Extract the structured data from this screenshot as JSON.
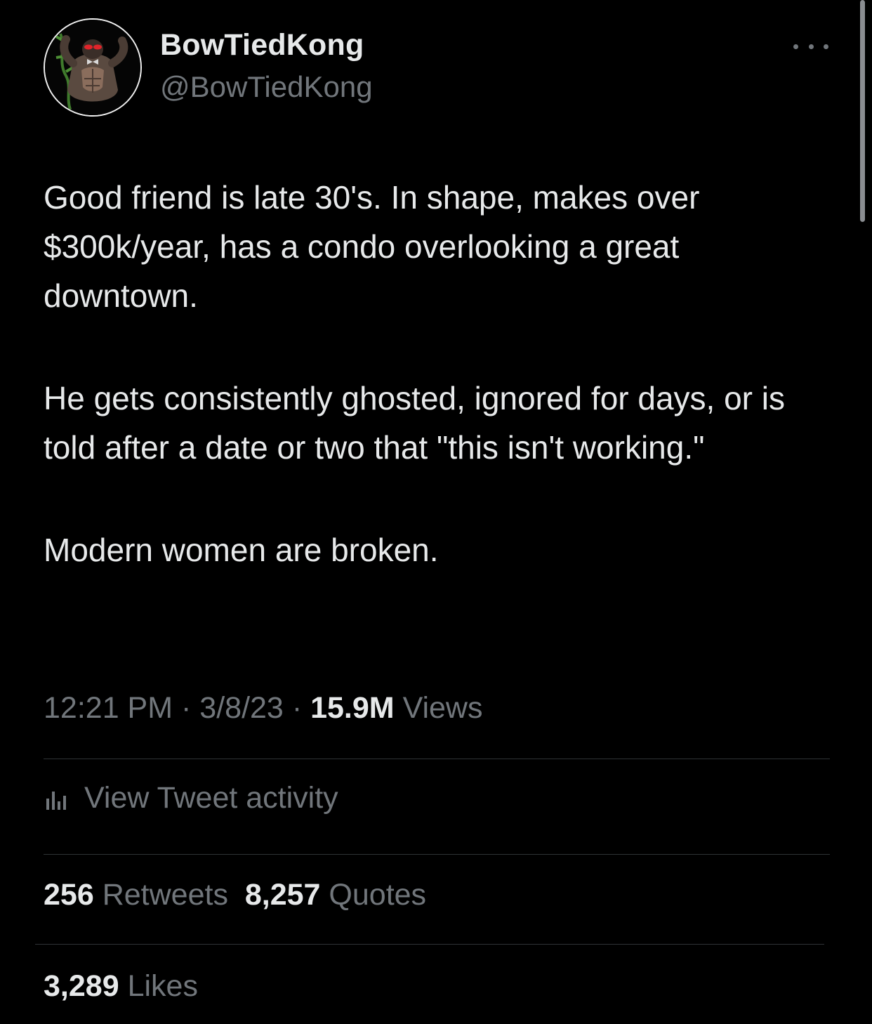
{
  "author": {
    "display_name": "BowTiedKong",
    "handle": "@BowTiedKong",
    "avatar_icon": "gorilla-avatar-icon"
  },
  "more_icon": "more-horizontal-icon",
  "tweet": {
    "paragraphs": [
      "Good friend is late 30's. In shape, makes over $300k/year, has a condo overlooking a great downtown.",
      "He gets consistently ghosted, ignored for days, or is told after a date or two that \"this isn't working.\"",
      "Modern women are broken."
    ]
  },
  "meta": {
    "time": "12:21 PM",
    "separator": "·",
    "date": "3/8/23",
    "views_count": "15.9M",
    "views_label": "Views"
  },
  "activity": {
    "icon": "bar-chart-icon",
    "label": "View Tweet activity"
  },
  "stats": {
    "retweets_count": "256",
    "retweets_label": "Retweets",
    "quotes_count": "8,257",
    "quotes_label": "Quotes",
    "likes_count": "3,289",
    "likes_label": "Likes"
  },
  "colors": {
    "background": "#000000",
    "primary_text": "#e7e9ea",
    "secondary_text": "#71767b",
    "divider": "#2f3336"
  }
}
